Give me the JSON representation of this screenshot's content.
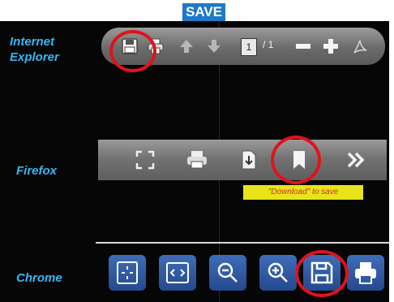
{
  "title": "SAVE",
  "rows": {
    "ie": {
      "label": "Internet Explorer",
      "label_line1": "Internet",
      "label_line2": "Explorer",
      "page_current": "1",
      "page_separator": "/",
      "page_total": "1"
    },
    "firefox": {
      "label": "Firefox",
      "tooltip": "\"Download\" to save"
    },
    "chrome": {
      "label": "Chrome"
    }
  },
  "colors": {
    "label": "#39b6f5",
    "highlight": "#e0121d",
    "tooltip_bg": "#e8e41a",
    "chrome_button": "#2f5aa6"
  },
  "icons": {
    "ie": [
      "save-icon",
      "print-icon",
      "arrow-up-icon",
      "arrow-down-icon",
      "minus-icon",
      "plus-icon",
      "adobe-icon"
    ],
    "firefox": [
      "fullscreen-icon",
      "print-icon",
      "download-icon",
      "bookmark-icon",
      "more-icon"
    ],
    "chrome": [
      "fit-page-icon",
      "fit-width-icon",
      "zoom-out-icon",
      "zoom-in-icon",
      "save-icon",
      "print-icon"
    ]
  }
}
